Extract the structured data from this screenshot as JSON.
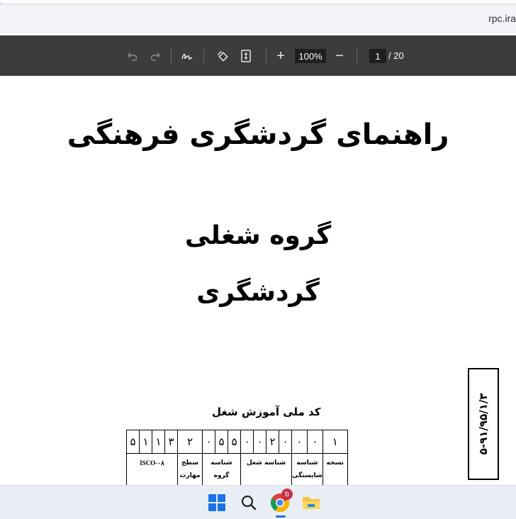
{
  "browser": {
    "url_text": "rpc.ira"
  },
  "pdf_toolbar": {
    "icons": [
      "undo-icon",
      "redo-icon",
      "annotate-icon",
      "rotate-icon",
      "page-fit-icon",
      "zoom-in-icon",
      "zoom-out-icon"
    ],
    "zoom": "100%",
    "zoom_in_label": "+",
    "zoom_out_label": "−",
    "current_page": "1",
    "total_pages": "/ 20"
  },
  "document": {
    "title": "راهنمای گردشگری فرهنگی",
    "group_label": "گروه شغلی",
    "group_value": "گردشگری",
    "code_label": "کد ملی آموزش شغل",
    "side_code": "۵-۹۱/۹۵/۱/۳",
    "code_digits": [
      "۵",
      "۱",
      "۱",
      "۳",
      "۲",
      "۰",
      "۵",
      "۵",
      "۰",
      "۰",
      "۲",
      "۰",
      "۰",
      "۰",
      "۱"
    ],
    "isco": "ISCO-۰۸",
    "col_skill_level": "سطح مهارت",
    "col_group_id": "شناسه گروه",
    "col_job_id": "شناسه شغل",
    "col_competency_id": "شناسه شایستگی",
    "col_version": "نسخه"
  },
  "taskbar": {
    "icons": [
      "windows-start-icon",
      "search-icon",
      "chrome-icon",
      "file-explorer-icon"
    ],
    "chrome_badge": "b"
  },
  "colors": {
    "toolbar_bg": "#3c3c3c",
    "taskbar_bg": "#e9eef5",
    "badge": "#c4314b"
  }
}
